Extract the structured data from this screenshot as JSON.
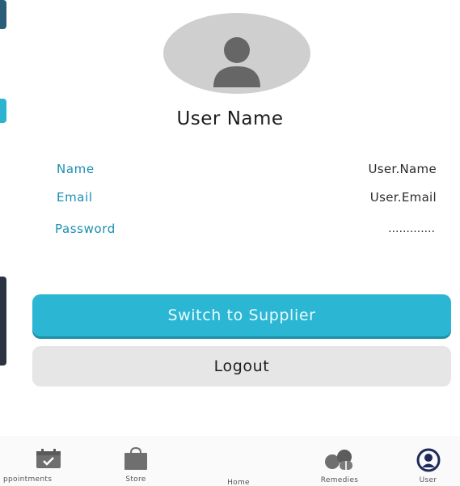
{
  "profile": {
    "title": "User Name",
    "avatar_icon": "person-avatar-icon"
  },
  "fields": {
    "name": {
      "label": "Name",
      "value": "User.Name"
    },
    "email": {
      "label": "Email",
      "value": "User.Email"
    },
    "password": {
      "label": "Password",
      "value": "............."
    }
  },
  "actions": {
    "switch_label": "Switch to Supplier",
    "logout_label": "Logout"
  },
  "nav": {
    "items": [
      {
        "label": "ppointments",
        "icon": "calendar-check-icon"
      },
      {
        "label": "Store",
        "icon": "shopping-bag-icon"
      },
      {
        "label": "Home",
        "icon": ""
      },
      {
        "label": "Remedies",
        "icon": "pills-icon"
      },
      {
        "label": "User",
        "icon": "user-circle-icon"
      }
    ]
  },
  "colors": {
    "accent": "#2bb7d3",
    "label_blue": "#1a8fb0",
    "logout_bg": "#e6e6e6",
    "avatar_bg": "#cfcfcf",
    "avatar_fg": "#666666",
    "nav_icon": "#6f6f6f",
    "user_icon_active": "#1e2a5a"
  }
}
